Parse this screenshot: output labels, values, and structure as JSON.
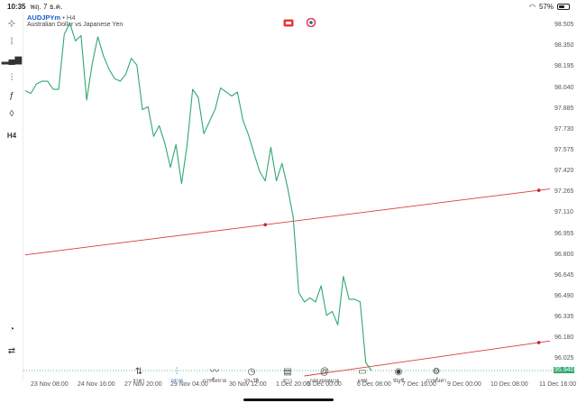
{
  "status_bar": {
    "time": "10:35",
    "date": "พฤ. 7 ธ.ค.",
    "battery": "57%",
    "battery_level": 0.57
  },
  "chart_header": {
    "symbol": "AUDJPYm",
    "separator": "•",
    "timeframe": "H4",
    "description": "Australian Dollar vs Japanese Yen"
  },
  "left_toolbar": {
    "items": [
      {
        "name": "crosshair-icon",
        "glyph": "⊹"
      },
      {
        "name": "chart-type-icon",
        "glyph": "⁞"
      },
      {
        "name": "indicators-icon",
        "glyph": "▂▄▆"
      },
      {
        "name": "adjust-icon",
        "glyph": "⫶"
      },
      {
        "name": "function-icon",
        "glyph": "ƒ"
      },
      {
        "name": "objects-icon",
        "glyph": "◊"
      },
      {
        "name": "timeframe-button",
        "glyph": "H4"
      }
    ],
    "bottom_items": [
      {
        "name": "timer-icon",
        "glyph": "◔"
      },
      {
        "name": "trade-icon",
        "glyph": "⇄"
      }
    ]
  },
  "price_axis": {
    "ticks": [
      "98.505",
      "98.350",
      "98.195",
      "98.040",
      "97.885",
      "97.730",
      "97.575",
      "97.420",
      "97.265",
      "97.110",
      "96.955",
      "96.800",
      "96.645",
      "96.490",
      "96.335",
      "96.180",
      "96.025"
    ],
    "current_price": "95.940"
  },
  "time_axis": {
    "labels": [
      "23 Nov 08:00",
      "24 Nov 16:00",
      "27 Nov 20:00",
      "29 Nov 04:00",
      "30 Nov 12:00",
      "1 Dec 20:00",
      "5 Dec 00:00",
      "6 Dec 08:00",
      "7 Dec 16:00",
      "9 Dec 00:00",
      "10 Dec 08:00",
      "11 Dec 16:00"
    ]
  },
  "chart_data": {
    "type": "line",
    "symbol": "AUDJPYm",
    "ylim": [
      95.94,
      98.6
    ],
    "x": [
      0,
      1,
      2,
      3,
      4,
      5,
      6,
      7,
      8,
      9,
      10,
      11,
      12,
      13,
      14,
      15,
      16,
      17,
      18,
      19,
      20,
      21,
      22,
      23,
      24,
      25,
      26,
      27,
      28,
      29,
      30,
      31,
      32,
      33,
      34,
      35,
      36,
      37,
      38,
      39,
      40,
      41,
      42,
      43,
      44,
      45,
      46,
      47,
      48,
      49,
      50,
      51,
      52,
      53,
      54,
      55,
      56,
      57,
      58,
      59,
      60,
      61,
      62
    ],
    "y": [
      98.02,
      98.0,
      98.07,
      98.09,
      98.09,
      98.03,
      98.03,
      98.44,
      98.52,
      98.39,
      98.43,
      97.95,
      98.22,
      98.42,
      98.28,
      98.18,
      98.11,
      98.09,
      98.14,
      98.26,
      98.21,
      97.88,
      97.9,
      97.68,
      97.76,
      97.63,
      97.45,
      97.62,
      97.33,
      97.62,
      98.03,
      97.97,
      97.7,
      97.79,
      97.88,
      98.04,
      98.01,
      97.98,
      98.01,
      97.8,
      97.69,
      97.55,
      97.42,
      97.35,
      97.6,
      97.35,
      97.48,
      97.3,
      97.08,
      96.52,
      96.45,
      96.48,
      96.45,
      96.57,
      96.35,
      96.38,
      96.28,
      96.64,
      96.47,
      96.47,
      96.45,
      96.0,
      95.94
    ],
    "trend_lines": [
      {
        "from": [
          0,
          96.8
        ],
        "to": [
          94,
          97.29
        ],
        "color": "#e0393e"
      },
      {
        "from": [
          50,
          95.9
        ],
        "to": [
          94,
          96.16
        ],
        "color": "#e0393e"
      }
    ],
    "x_labels": [
      "23 Nov 08:00",
      "24 Nov 16:00",
      "27 Nov 20:00",
      "29 Nov 04:00",
      "30 Nov 12:00",
      "1 Dec 20:00",
      "5 Dec 00:00",
      "6 Dec 08:00",
      "7 Dec 16:00",
      "9 Dec 00:00",
      "10 Dec 08:00",
      "11 Dec 16:00"
    ],
    "y_ticks": [
      98.505,
      98.35,
      98.195,
      98.04,
      97.885,
      97.73,
      97.575,
      97.42,
      97.265,
      97.11,
      96.955,
      96.8,
      96.645,
      96.49,
      96.335,
      96.18,
      96.025
    ],
    "line_color": "#2fa86f",
    "grid": false
  },
  "bottom_nav": {
    "items": [
      {
        "name": "nav-quotes",
        "icon": "⇅",
        "label": "ราคา"
      },
      {
        "name": "nav-chart",
        "icon": "⫶",
        "label": "กราฟ",
        "active": true
      },
      {
        "name": "nav-trade",
        "icon": "〰",
        "label": "การซื้อขาย"
      },
      {
        "name": "nav-history",
        "icon": "◷",
        "label": "ประวัติ"
      },
      {
        "name": "nav-news",
        "icon": "▤",
        "label": "ข่าว"
      },
      {
        "name": "nav-mailbox",
        "icon": "@",
        "label": "กล่องจดหมาย"
      },
      {
        "name": "nav-chat",
        "icon": "▭",
        "label": "แชท"
      },
      {
        "name": "nav-account",
        "icon": "◉",
        "label": "บัญชี"
      },
      {
        "name": "nav-settings",
        "icon": "⚙",
        "label": "การตั้งค่า"
      }
    ]
  }
}
